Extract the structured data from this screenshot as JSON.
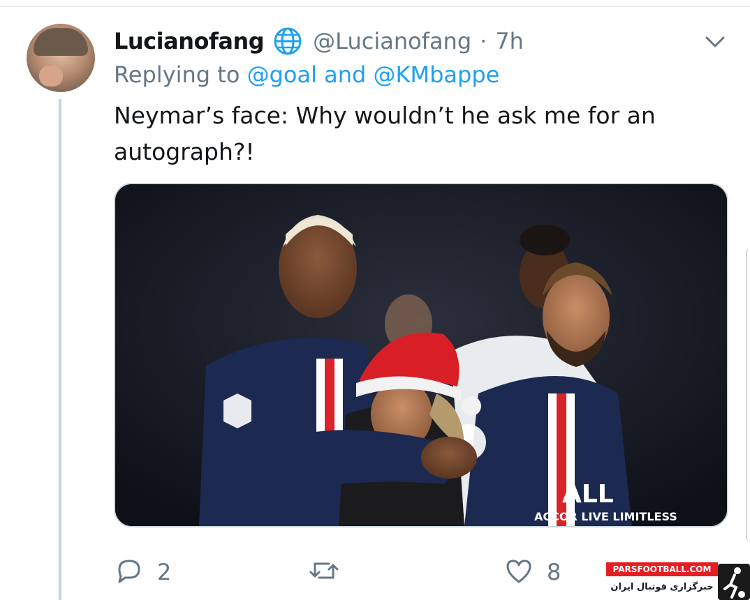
{
  "tweet": {
    "display_name": "Lucianofang",
    "handle": "@Lucianofang",
    "separator": "·",
    "time": "7h",
    "reply_prefix": "Replying to",
    "reply_mention_1": "@goal",
    "reply_and": "and",
    "reply_mention_2": "@KMbappe",
    "text": "Neymar’s face: Why wouldn’t he ask me for an autograph?!",
    "media_icons": [
      "avatar",
      "globe-icon",
      "chevron-down-icon"
    ]
  },
  "actions": {
    "reply_count": "2",
    "retweet_count": "",
    "like_count": "8"
  },
  "photo_text": {
    "sponsor_text": "ACCOR LIVE LIMITLESS",
    "sponsor_short": "ALL"
  },
  "watermark": {
    "site": "PARSFOOTBALL.COM",
    "tagline": "خبرگزاری فوتبال ایران"
  },
  "colors": {
    "accent": "#1da1f2",
    "muted": "#657786",
    "text": "#14171a",
    "psg_navy": "#1c2a52",
    "psg_red": "#d8232a"
  }
}
